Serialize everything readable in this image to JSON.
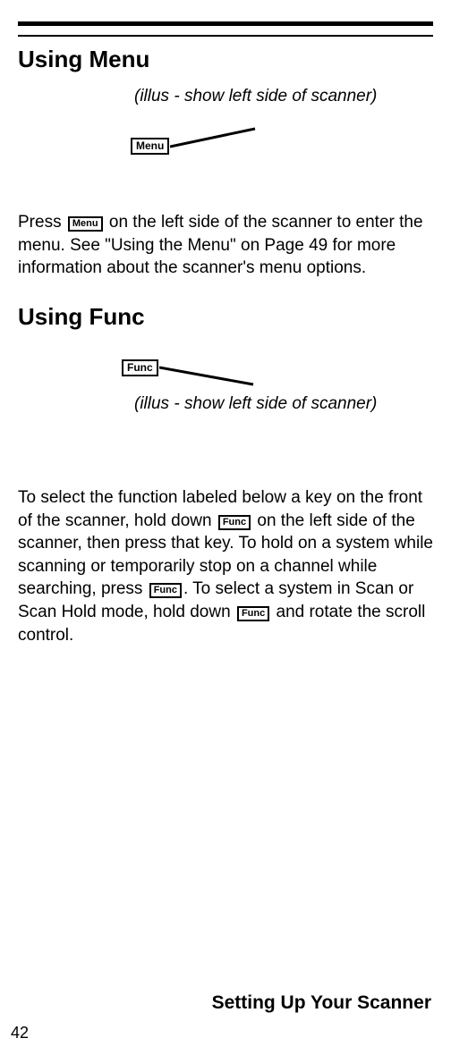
{
  "section1": {
    "heading": "Using Menu",
    "illus_text": "(illus - show left side of scanner)",
    "key_label": "Menu",
    "paragraph_parts": {
      "p1": "Press ",
      "key1": "Menu",
      "p2": " on the left side of the scanner to enter the menu. See \"Using the Menu\" on Page 49 for more information about the scanner's menu options."
    }
  },
  "section2": {
    "heading": "Using Func",
    "illus_text": "(illus - show left side of scanner)",
    "key_label": "Func",
    "paragraph_parts": {
      "p1": "To select the function labeled below a key on the front of the scanner, hold down ",
      "key1": "Func",
      "p2": " on the left side of the scanner, then press that key. To hold on a system while scanning or temporarily stop on a channel while searching, press ",
      "key2": "Func",
      "p3": ". To select a system in Scan or Scan Hold mode, hold down ",
      "key3": "Func",
      "p4": " and rotate the scroll control."
    }
  },
  "footer": {
    "title": "Setting Up Your Scanner",
    "page_number": "42"
  }
}
